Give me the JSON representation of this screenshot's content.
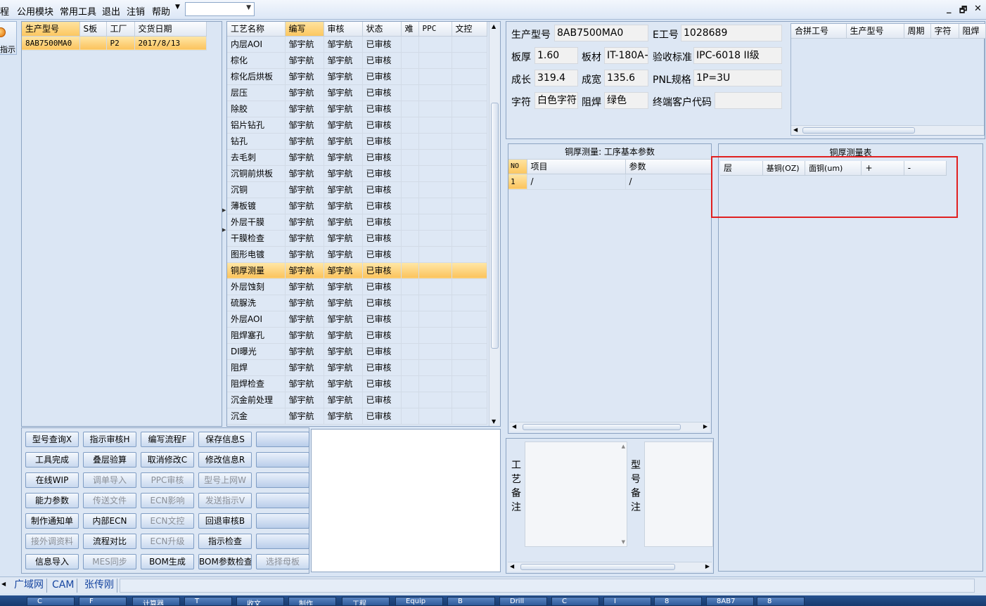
{
  "menubar": {
    "items": [
      "程",
      "公用模块",
      "常用工具",
      "退出",
      "注销",
      "帮助"
    ],
    "combo_value": "",
    "window_controls": {
      "minimize": "_",
      "restore": "🗗",
      "close": "✕"
    }
  },
  "left_stub": {
    "label": "指示"
  },
  "order_grid": {
    "columns": [
      "生产型号",
      "S板",
      "工厂",
      "交货日期"
    ],
    "rows": [
      [
        "8AB7500MA0",
        "",
        "P2",
        "2017/8/13"
      ]
    ]
  },
  "process_grid": {
    "columns": [
      "工艺名称",
      "编写",
      "审核",
      "状态",
      "难",
      "PPC",
      "文控"
    ],
    "rows": [
      [
        "内层AOI",
        "邹宇航",
        "邹宇航",
        "已审核"
      ],
      [
        "棕化",
        "邹宇航",
        "邹宇航",
        "已审核"
      ],
      [
        "棕化后烘板",
        "邹宇航",
        "邹宇航",
        "已审核"
      ],
      [
        "层压",
        "邹宇航",
        "邹宇航",
        "已审核"
      ],
      [
        "除胶",
        "邹宇航",
        "邹宇航",
        "已审核"
      ],
      [
        "铝片钻孔",
        "邹宇航",
        "邹宇航",
        "已审核"
      ],
      [
        "钻孔",
        "邹宇航",
        "邹宇航",
        "已审核"
      ],
      [
        "去毛刺",
        "邹宇航",
        "邹宇航",
        "已审核"
      ],
      [
        "沉铜前烘板",
        "邹宇航",
        "邹宇航",
        "已审核"
      ],
      [
        "沉铜",
        "邹宇航",
        "邹宇航",
        "已审核"
      ],
      [
        "薄板镀",
        "邹宇航",
        "邹宇航",
        "已审核"
      ],
      [
        "外层干膜",
        "邹宇航",
        "邹宇航",
        "已审核"
      ],
      [
        "干膜检查",
        "邹宇航",
        "邹宇航",
        "已审核"
      ],
      [
        "图形电镀",
        "邹宇航",
        "邹宇航",
        "已审核"
      ],
      [
        "铜厚测量",
        "邹宇航",
        "邹宇航",
        "已审核"
      ],
      [
        "外层蚀刻",
        "邹宇航",
        "邹宇航",
        "已审核"
      ],
      [
        "硫脲洗",
        "邹宇航",
        "邹宇航",
        "已审核"
      ],
      [
        "外层AOI",
        "邹宇航",
        "邹宇航",
        "已审核"
      ],
      [
        "阻焊塞孔",
        "邹宇航",
        "邹宇航",
        "已审核"
      ],
      [
        "DI曝光",
        "邹宇航",
        "邹宇航",
        "已审核"
      ],
      [
        "阻焊",
        "邹宇航",
        "邹宇航",
        "已审核"
      ],
      [
        "阻焊检查",
        "邹宇航",
        "邹宇航",
        "已审核"
      ],
      [
        "沉金前处理",
        "邹宇航",
        "邹宇航",
        "已审核"
      ],
      [
        "沉金",
        "邹宇航",
        "邹宇航",
        "已审核"
      ]
    ],
    "selected_row": 14
  },
  "buttons": [
    [
      {
        "label": "型号查询X",
        "disabled": false
      },
      {
        "label": "指示审核H",
        "disabled": false
      },
      {
        "label": "编写流程F",
        "disabled": false
      },
      {
        "label": "保存信息S",
        "disabled": false
      },
      {
        "label": "",
        "disabled": false
      }
    ],
    [
      {
        "label": "工具完成",
        "disabled": false
      },
      {
        "label": "叠层验算",
        "disabled": false
      },
      {
        "label": "取消修改C",
        "disabled": false
      },
      {
        "label": "修改信息R",
        "disabled": false
      },
      {
        "label": "",
        "disabled": false
      }
    ],
    [
      {
        "label": "在线WIP",
        "disabled": false
      },
      {
        "label": "调单导入",
        "disabled": true
      },
      {
        "label": "PPC审核",
        "disabled": true
      },
      {
        "label": "型号上网W",
        "disabled": true
      },
      {
        "label": "",
        "disabled": false
      }
    ],
    [
      {
        "label": "能力参数",
        "disabled": false
      },
      {
        "label": "传送文件",
        "disabled": true
      },
      {
        "label": "ECN影响",
        "disabled": true
      },
      {
        "label": "发送指示V",
        "disabled": true
      },
      {
        "label": "",
        "disabled": false
      }
    ],
    [
      {
        "label": "制作通知单",
        "disabled": false
      },
      {
        "label": "内部ECN",
        "disabled": false
      },
      {
        "label": "ECN文控",
        "disabled": true
      },
      {
        "label": "回退审核B",
        "disabled": false
      },
      {
        "label": "",
        "disabled": false
      }
    ],
    [
      {
        "label": "接外调资料",
        "disabled": true
      },
      {
        "label": "流程对比",
        "disabled": false
      },
      {
        "label": "ECN升级",
        "disabled": true
      },
      {
        "label": "指示检查",
        "disabled": false
      },
      {
        "label": "",
        "disabled": false
      }
    ],
    [
      {
        "label": "信息导入",
        "disabled": false
      },
      {
        "label": "MES同步",
        "disabled": true
      },
      {
        "label": "BOM生成",
        "disabled": false
      },
      {
        "label": "BOM参数检查",
        "disabled": false
      },
      {
        "label": "选择母板",
        "disabled": true
      }
    ]
  ],
  "info": {
    "product_model_label": "生产型号",
    "product_model": "8AB7500MA0",
    "e_no_label": "E工号",
    "e_no": "1028689",
    "thickness_label": "板厚",
    "thickness": "1.60",
    "material_label": "板材",
    "material": "IT-180A+",
    "standard_label": "验收标准",
    "standard": "IPC-6018 II级",
    "length_label": "成长",
    "length": "319.4",
    "width_label": "成宽",
    "width": "135.6",
    "pnl_label": "PNL规格",
    "pnl": "1P=3U",
    "char_label": "字符",
    "char": "白色字符",
    "solder_label": "阻焊",
    "solder": "绿色",
    "customer_label": "终端客户代码",
    "customer": ""
  },
  "merge_grid": {
    "columns": [
      "合拼工号",
      "生产型号",
      "周期",
      "字符",
      "阻焊"
    ]
  },
  "params_panel": {
    "title": "铜厚测量: 工序基本参数",
    "columns": [
      "NO",
      "项目",
      "参数"
    ],
    "rows": [
      [
        "1",
        "/",
        "/"
      ]
    ]
  },
  "measure_panel": {
    "title": "铜厚测量表",
    "columns": [
      "层",
      "基铜(OZ)",
      "面铜(um)",
      "+",
      "-"
    ]
  },
  "remarks": {
    "process_label": "工艺备注",
    "model_label": "型号备注"
  },
  "statusbar": {
    "tabs": [
      "广域网",
      "CAM",
      "张传刚"
    ]
  },
  "taskbar": {
    "items": [
      "C",
      "F",
      "计算器",
      "T",
      "收文",
      "制作",
      "工程",
      "Equip",
      "B",
      "Drill",
      "C",
      "I",
      "8",
      "8AB7",
      "8"
    ]
  }
}
